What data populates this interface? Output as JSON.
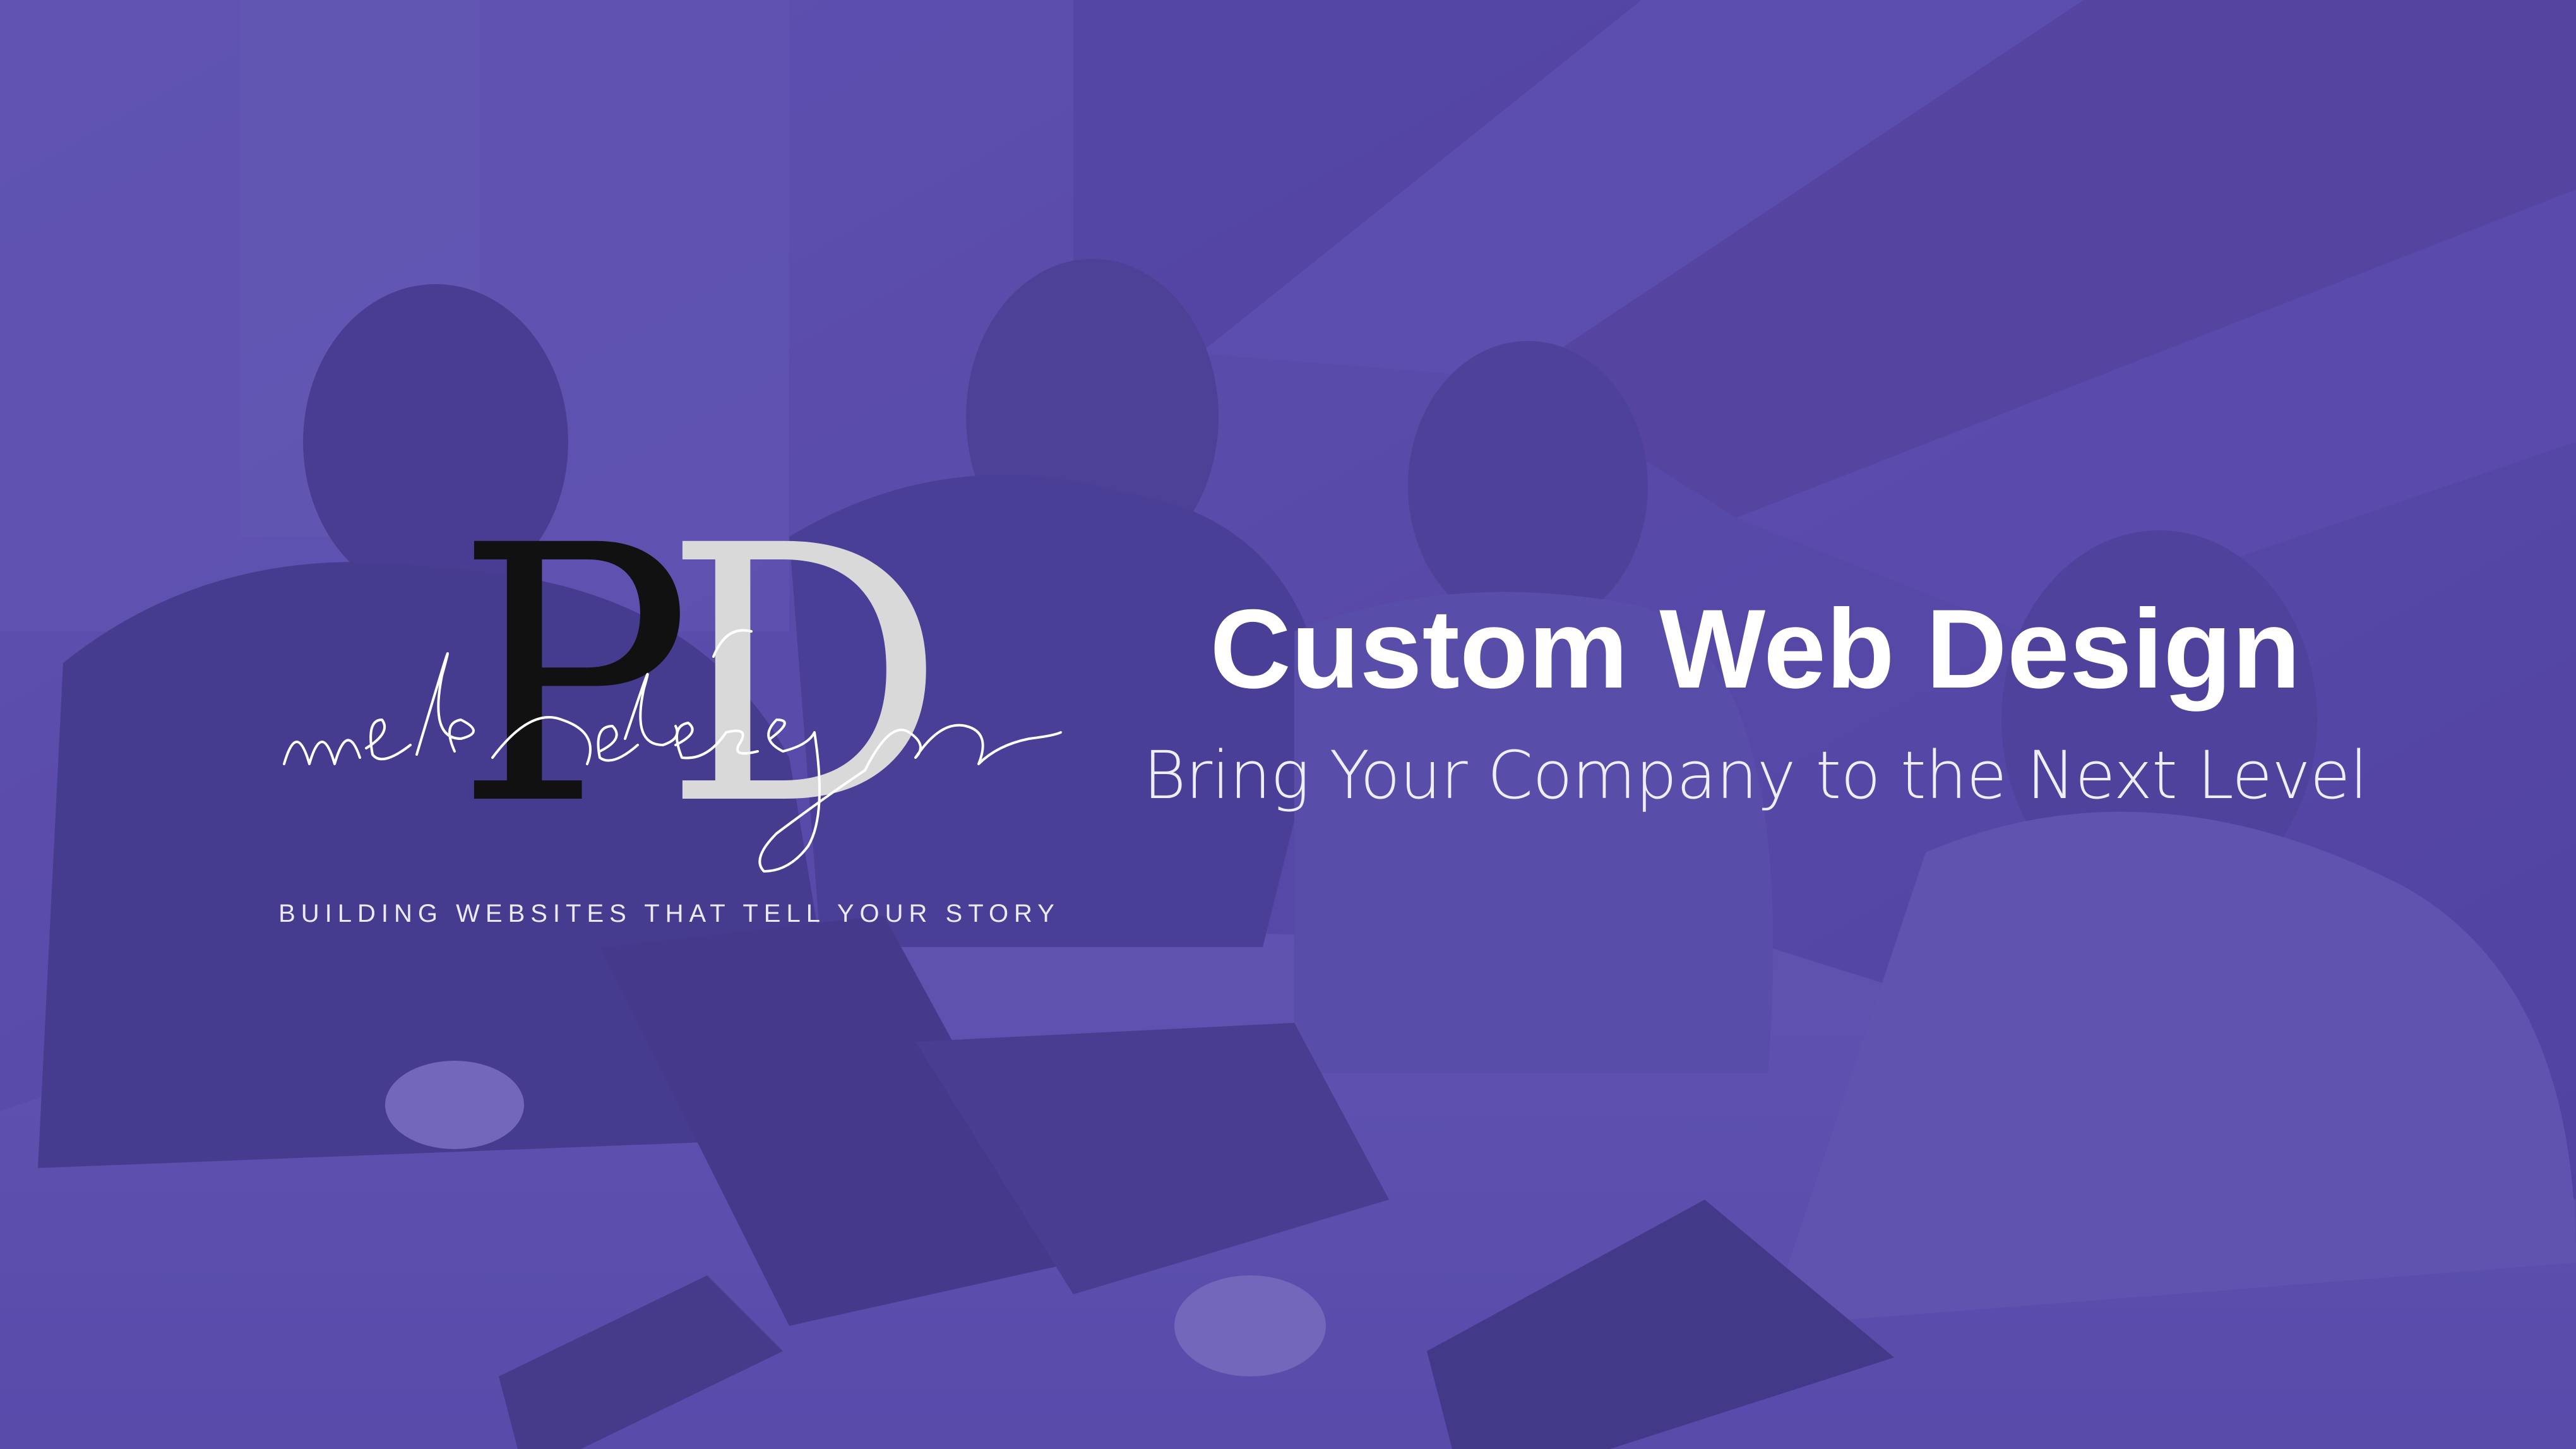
{
  "brand": {
    "monogram_left": "P",
    "monogram_right": "D",
    "script_text": "web design",
    "tagline": "BUILDING WEBSITES THAT TELL YOUR STORY"
  },
  "hero": {
    "headline": "Custom Web Design",
    "subheadline": "Bring Your Company to the Next Level"
  },
  "background": {
    "description_icon": "team-meeting-photo",
    "overlay_color": "#5a4ba6"
  }
}
